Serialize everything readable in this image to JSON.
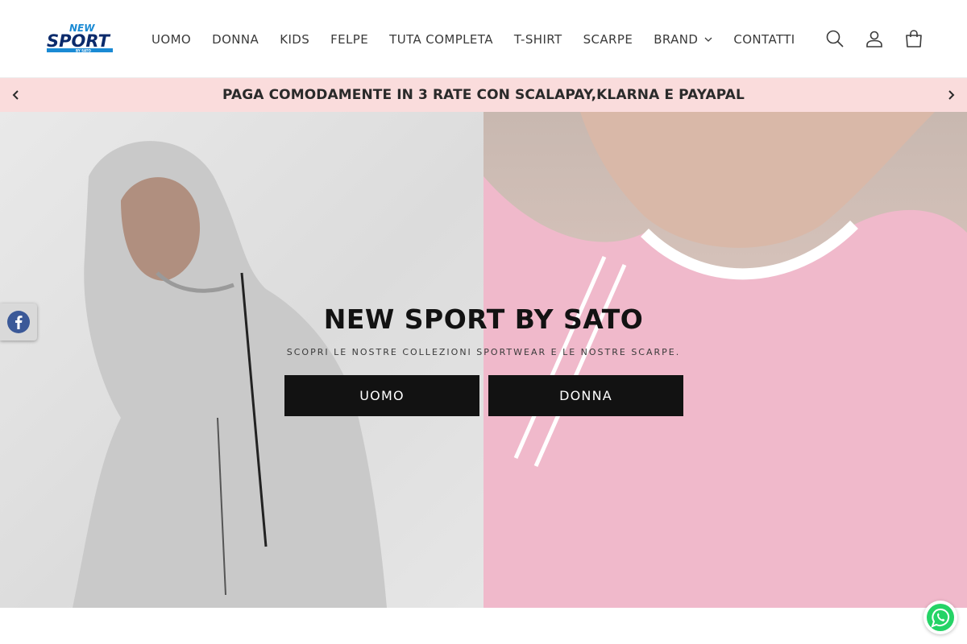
{
  "brand": {
    "logo_text_top": "NEW",
    "logo_text_main": "SPORT",
    "logo_text_sub": "BY SATO",
    "logo_primary_color": "#1a8ad4",
    "logo_dark_color": "#0b2a6b"
  },
  "nav": {
    "items": [
      {
        "label": "UOMO"
      },
      {
        "label": "DONNA"
      },
      {
        "label": "KIDS"
      },
      {
        "label": "FELPE"
      },
      {
        "label": "TUTA COMPLETA"
      },
      {
        "label": "T-SHIRT"
      },
      {
        "label": "SCARPE"
      },
      {
        "label": "BRAND",
        "icon": "chevron-down-icon"
      },
      {
        "label": "CONTATTI"
      }
    ]
  },
  "header_icons": [
    "search-icon",
    "account-icon",
    "cart-icon"
  ],
  "announcement": {
    "text": "PAGA COMODAMENTE IN 3 RATE CON SCALAPAY,KLARNA E PAYAPAL",
    "background": "#fadcdc"
  },
  "hero": {
    "title": "NEW SPORT BY SATO",
    "subtitle": "SCOPRI LE NOSTRE COLLEZIONI SPORTWEAR E LE NOSTRE SCARPE.",
    "buttons": [
      {
        "label": "UOMO"
      },
      {
        "label": "DONNA"
      }
    ]
  },
  "widgets": {
    "facebook_icon": "facebook-icon",
    "whatsapp_icon": "whatsapp-icon",
    "whatsapp_color": "#25d366"
  }
}
